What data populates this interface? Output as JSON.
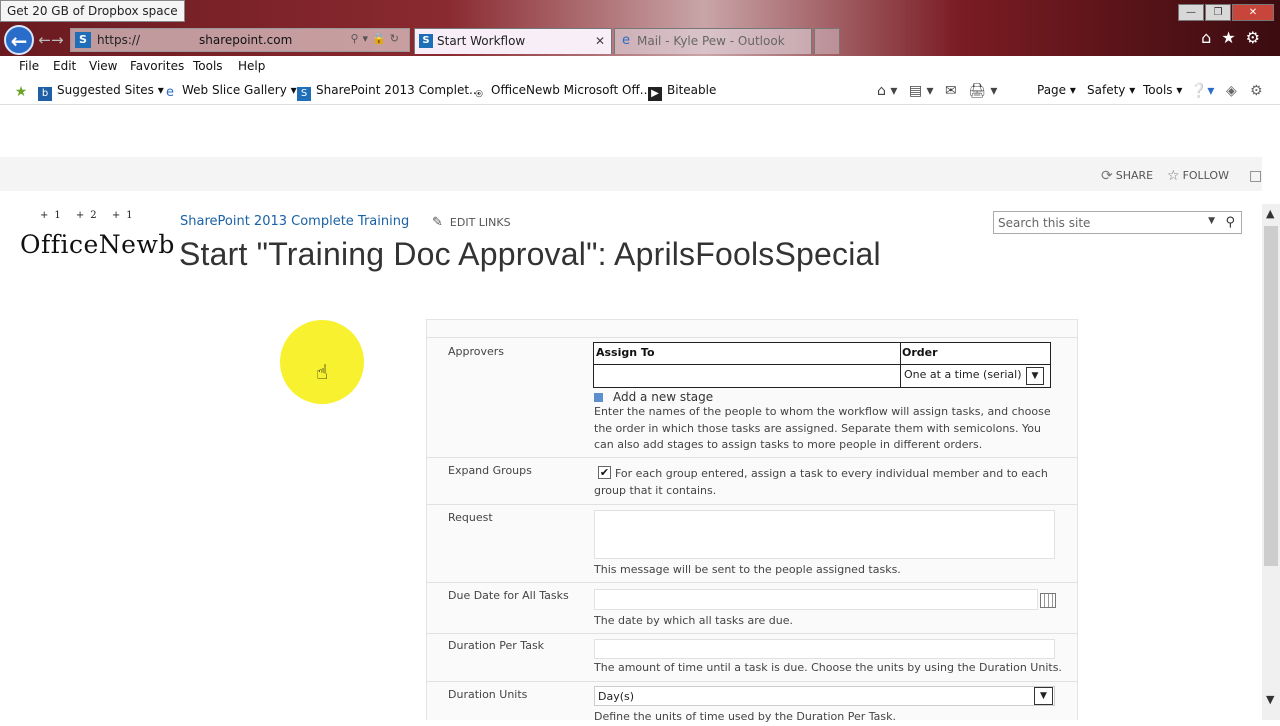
{
  "browser": {
    "tooltip": "Get 20 GB of Dropbox space",
    "address": {
      "protocol": "https://",
      "host": "sharepoint.com"
    },
    "tabs": [
      {
        "label": "Start Workflow",
        "active": true
      },
      {
        "label": "Mail - Kyle Pew - Outlook",
        "active": false
      }
    ],
    "menu": [
      "File",
      "Edit",
      "View",
      "Favorites",
      "Tools",
      "Help"
    ],
    "favorites": [
      "Suggested Sites",
      "Web Slice Gallery",
      "SharePoint 2013 Complet...",
      "OfficeNewb Microsoft Off...",
      "Biteable"
    ],
    "command_bar": [
      "Page",
      "Safety",
      "Tools"
    ]
  },
  "suite": {
    "share_label": "SHARE",
    "follow_label": "FOLLOW"
  },
  "site": {
    "logo_text": "OfficeNewb",
    "logo_marks": "+1  +2 +1",
    "title": "SharePoint 2013 Complete Training",
    "edit_links": "EDIT LINKS",
    "page_title": "Start \"Training Doc Approval\": AprilsFoolsSpecial",
    "search_placeholder": "Search this site"
  },
  "form": {
    "approvers": {
      "label": "Approvers",
      "col_assign": "Assign To",
      "col_order": "Order",
      "order_value": "One at a time (serial)",
      "add_stage": "Add a new stage",
      "help": "Enter the names of the people to whom the workflow will assign tasks, and choose the order in which those tasks are assigned. Separate them with semicolons. You can also add stages to assign tasks to more people in different orders."
    },
    "expand_groups": {
      "label": "Expand Groups",
      "checked": true,
      "text": "For each group entered, assign a task to every individual member and to each group that it contains."
    },
    "request": {
      "label": "Request",
      "help": "This message will be sent to the people assigned tasks."
    },
    "due_date": {
      "label": "Due Date for All Tasks",
      "help": "The date by which all tasks are due."
    },
    "duration": {
      "label": "Duration Per Task",
      "help": "The amount of time until a task is due. Choose the units by using the Duration Units."
    },
    "duration_units": {
      "label": "Duration Units",
      "value": "Day(s)",
      "help": "Define the units of time used by the Duration Per Task."
    }
  },
  "colors": {
    "accent_blue": "#1a61a5",
    "cursor_highlight": "#f7f025"
  }
}
